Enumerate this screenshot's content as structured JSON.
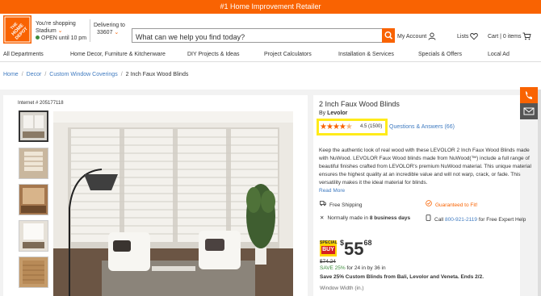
{
  "promo_bar": "#1 Home Improvement Retailer",
  "header": {
    "logo_text": "THE HOME DEPOT",
    "store_line1": "You're shopping",
    "store_name": "Stadium",
    "store_status": "OPEN until 10 pm",
    "deliver_label": "Delivering to",
    "zip": "33607",
    "search_placeholder": "What can we help you find today?",
    "account": "My Account",
    "lists": "Lists",
    "cart": "Cart | 0 items"
  },
  "nav": [
    "All Departments",
    "Home Decor, Furniture & Kitchenware",
    "DIY Projects & Ideas",
    "Project Calculators",
    "Installation & Services",
    "Specials & Offers",
    "Local Ad"
  ],
  "breadcrumbs": [
    "Home",
    "Decor",
    "Custom Window Coverings",
    "2 Inch Faux Wood Blinds"
  ],
  "product": {
    "internet_no": "Internet # 205177118",
    "title": "2 Inch Faux Wood Blinds",
    "by_label": "By",
    "brand": "Levolor",
    "rating": "4.5",
    "reviews": "(1500)",
    "qa": "Questions & Answers (66)",
    "description": "Keep the authentic look of real wood with these LEVOLOR 2 Inch Faux Wood Blinds made with NuWood. LEVOLOR Faux Wood blinds made from NuWood(™) include a full range of beautiful finishes crafted from LEVOLOR's premium NuWood material. This unique material ensures the highest quality at an incredible value and will not warp, crack, or fade. This versatility makes it the ideal material for blinds.",
    "read_more": "Read More",
    "free_shipping": "Free Shipping",
    "guaranteed": "Guaranteed to Fit!",
    "normally_made": "Normally made in",
    "business_days": "8 business days",
    "call_label": "Call",
    "phone": "800-921-2119",
    "call_suffix": "for Free Expert Help",
    "special_label": "SPECIAL",
    "buy_label": "BUY",
    "price_currency": "$",
    "price_dollars": "55",
    "price_cents": "68",
    "was_price": "$74.24",
    "save_text": "SAVE 25%",
    "save_size": "for 24 in by 36 in",
    "promo": "Save 25% Custom Blinds from Bali, Levolor and Veneta. Ends 2/2.",
    "width_label": "Window Width (in.)"
  },
  "colors": {
    "brand": "#f96302",
    "link": "#3e7ac0",
    "highlight": "#ffeb1a",
    "green": "#3e8c3d"
  }
}
